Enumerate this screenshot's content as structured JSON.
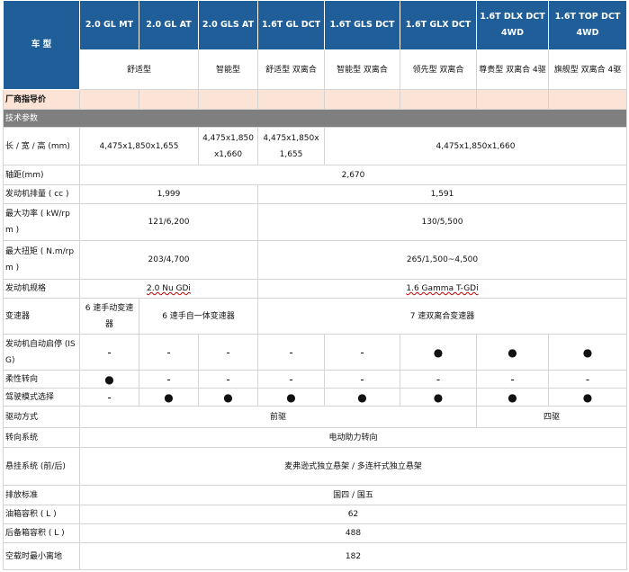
{
  "header": {
    "model_label": "车    型",
    "models": [
      "2.0 GL MT",
      "2.0 GL AT",
      "2.0 GLS AT",
      "1.6T GL DCT",
      "1.6T GLS DCT",
      "1.6T GLX DCT",
      "1.6T DLX DCT 4WD",
      "1.6T TOP DCT 4WD"
    ],
    "trims": [
      "舒适型",
      "智能型",
      "舒适型  双离合",
      "智能型  双离合",
      "领先型  双离合",
      "尊贵型  双离合 4驱",
      "旗舰型  双离合 4驱"
    ]
  },
  "price_label": "厂商指导价",
  "section_label": "技术参数",
  "rows": {
    "dims": {
      "label": "长 / 宽 / 高 (mm)",
      "v1": "4,475x1,850x1,655",
      "v2": "4,475x1,850x1,660",
      "v3": "4,475x1,850x 1,655",
      "v4": "4,475x1,850x1,660"
    },
    "wheelbase": {
      "label": "轴距(mm)",
      "v": "2,670"
    },
    "displacement": {
      "label": "发动机排量 ( cc )",
      "v1": "1,999",
      "v2": "1,591"
    },
    "power": {
      "label": "最大功率 ( kW/rpm )",
      "v1": "121/6,200",
      "v2": "130/5,500"
    },
    "torque": {
      "label": "最大扭矩 ( N.m/rpm )",
      "v1": "203/4,700",
      "v2": "265/1,500~4,500"
    },
    "engine": {
      "label": "发动机规格",
      "v1": "2.0 Nu GDi",
      "v2": "1.6 Gamma T-GDi"
    },
    "trans": {
      "label": "变速器",
      "v1": "6 速手动变速器",
      "v2": "6 速手自一体变速器",
      "v3": "7 速双离合变速器"
    },
    "isg": {
      "label": "发动机自动启停 (ISG)",
      "vals": [
        "-",
        "-",
        "-",
        "-",
        "-",
        "●",
        "●",
        "●"
      ]
    },
    "flex": {
      "label": "柔性转向",
      "vals": [
        "●",
        "-",
        "-",
        "-",
        "-",
        "-",
        "-",
        "-"
      ]
    },
    "drive_mode": {
      "label": "驾驶模式选择",
      "vals": [
        "-",
        "●",
        "●",
        "●",
        "●",
        "●",
        "●",
        "●"
      ]
    },
    "drivetrain": {
      "label": "驱动方式",
      "v1": "前驱",
      "v2": "四驱"
    },
    "steering": {
      "label": "转向系统",
      "v": "电动助力转向"
    },
    "suspension": {
      "label": "悬挂系统 (前/后)",
      "v": "麦弗逊式独立悬架  / 多连杆式独立悬架"
    },
    "emission": {
      "label": "排放标准",
      "v": "国四 / 国五"
    },
    "fuel": {
      "label": "油箱容积 ( L )",
      "v": "62"
    },
    "trunk": {
      "label": "后备箱容积 ( L )",
      "v": "488"
    },
    "clearance": {
      "label": "空载时最小离地",
      "v": "182"
    }
  },
  "colors": {
    "header_bg": "#1f5e98",
    "price_bg": "#fbe4d5",
    "section_bg": "#7f7f7f"
  }
}
